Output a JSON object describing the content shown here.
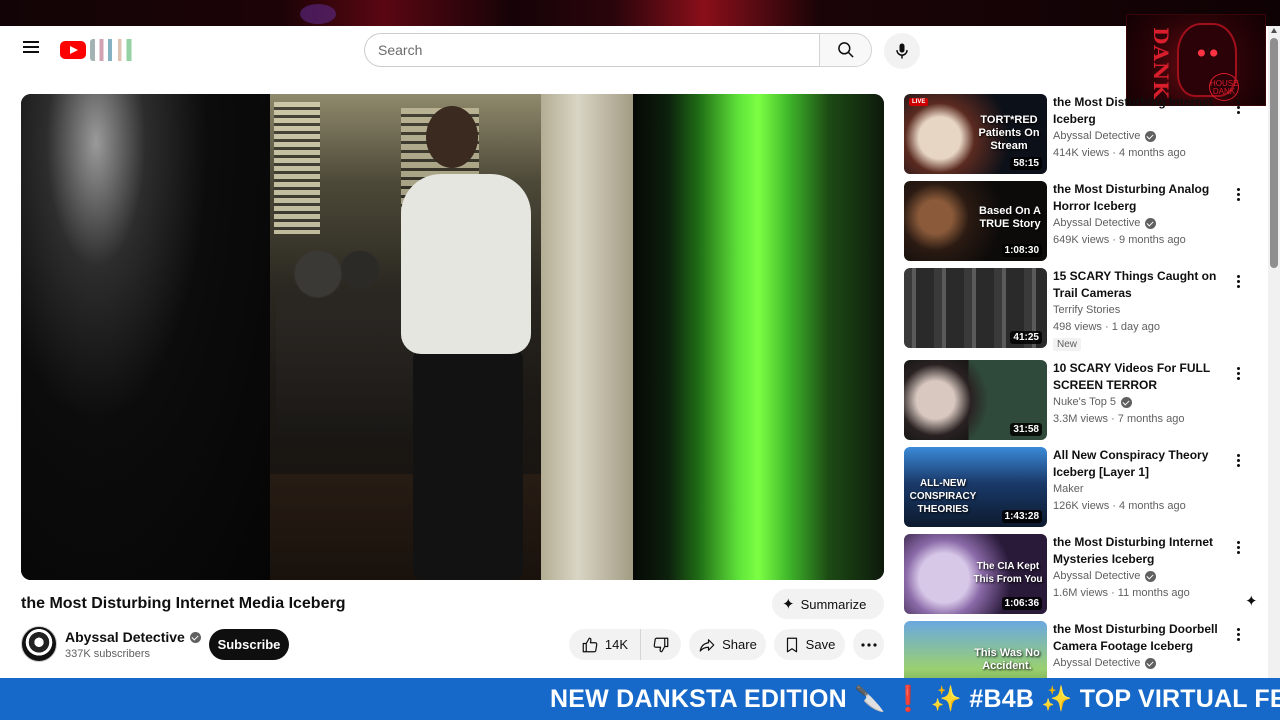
{
  "header": {
    "search_placeholder": "Search"
  },
  "video": {
    "title": "the Most Disturbing Internet Media Iceberg",
    "summarize_label": "Summarize",
    "channel": "Abyssal Detective",
    "subscribers": "337K subscribers",
    "subscribe_label": "Subscribe",
    "likes": "14K",
    "share_label": "Share",
    "save_label": "Save"
  },
  "overlay": {
    "logo_text": "DANK",
    "logo_sub": "HOUSE DANK"
  },
  "recommendations": [
    {
      "title": "the Most Disturbing Internet Iceberg",
      "channel": "Abyssal Detective",
      "verified": true,
      "meta": "414K views · 4 months ago",
      "duration": "58:15",
      "live_badge": "LIVE",
      "thumb_text": "TORT*RED Patients On Stream"
    },
    {
      "title": "the Most Disturbing Analog Horror Iceberg",
      "channel": "Abyssal Detective",
      "verified": true,
      "meta": "649K views · 9 months ago",
      "duration": "1:08:30",
      "thumb_text": "Based On A TRUE Story"
    },
    {
      "title": "15 SCARY Things Caught on Trail Cameras",
      "channel": "Terrify Stories",
      "verified": false,
      "meta": "498 views · 1 day ago",
      "duration": "41:25",
      "badge": "New"
    },
    {
      "title": "10 SCARY Videos For FULL SCREEN TERROR",
      "channel": "Nuke's Top 5",
      "verified": true,
      "meta": "3.3M views · 7 months ago",
      "duration": "31:58"
    },
    {
      "title": "All New Conspiracy Theory Iceberg [Layer 1]",
      "channel": "Maker",
      "verified": false,
      "meta": "126K views · 4 months ago",
      "duration": "1:43:28",
      "thumb_text": "ALL-NEW CONSPIRACY THEORIES"
    },
    {
      "title": "the Most Disturbing Internet Mysteries Iceberg",
      "channel": "Abyssal Detective",
      "verified": true,
      "meta": "1.6M views · 11 months ago",
      "duration": "1:06:36",
      "thumb_text": "The CIA Kept This From You"
    },
    {
      "title": "the Most Disturbing Doorbell Camera Footage Iceberg",
      "channel": "Abyssal Detective",
      "verified": true,
      "meta": "",
      "duration": "",
      "thumb_text": "This Was No Accident."
    }
  ],
  "ticker": {
    "text": "NEW DANKSTA EDITION 🔪 ❗ ✨ #B4B ✨ TOP VIRTUAL FE"
  },
  "colors": {
    "brand_red": "#ff0000",
    "ticker_blue": "#1769c9",
    "subscribe_black": "#0f0f0f",
    "text_secondary": "#606060"
  }
}
